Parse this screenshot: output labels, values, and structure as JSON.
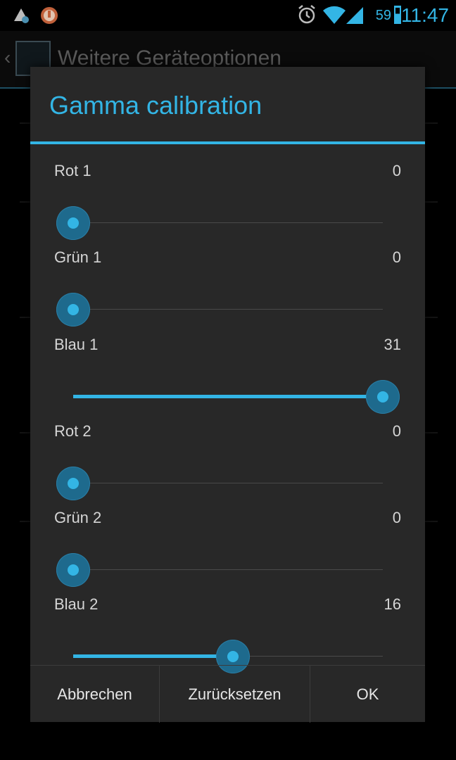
{
  "status_bar": {
    "time": "11:47",
    "battery": "59",
    "icons": [
      "debug-icon",
      "notification-icon",
      "alarm-icon",
      "wifi-icon",
      "signal-icon",
      "battery-icon"
    ],
    "accent": "#33b5e5"
  },
  "background": {
    "title": "Weitere Geräteoptionen"
  },
  "dialog": {
    "title": "Gamma calibration",
    "sliders": [
      {
        "label": "Rot 1",
        "value": "0",
        "level": 0
      },
      {
        "label": "Grün 1",
        "value": "0",
        "level": 0
      },
      {
        "label": "Blau 1",
        "value": "31",
        "level": 1
      },
      {
        "label": "Rot 2",
        "value": "0",
        "level": 0
      },
      {
        "label": "Grün 2",
        "value": "0",
        "level": 0
      },
      {
        "label": "Blau 2",
        "value": "16",
        "level": 0.516
      }
    ],
    "buttons": {
      "cancel": "Abbrechen",
      "reset": "Zurücksetzen",
      "ok": "OK"
    }
  }
}
